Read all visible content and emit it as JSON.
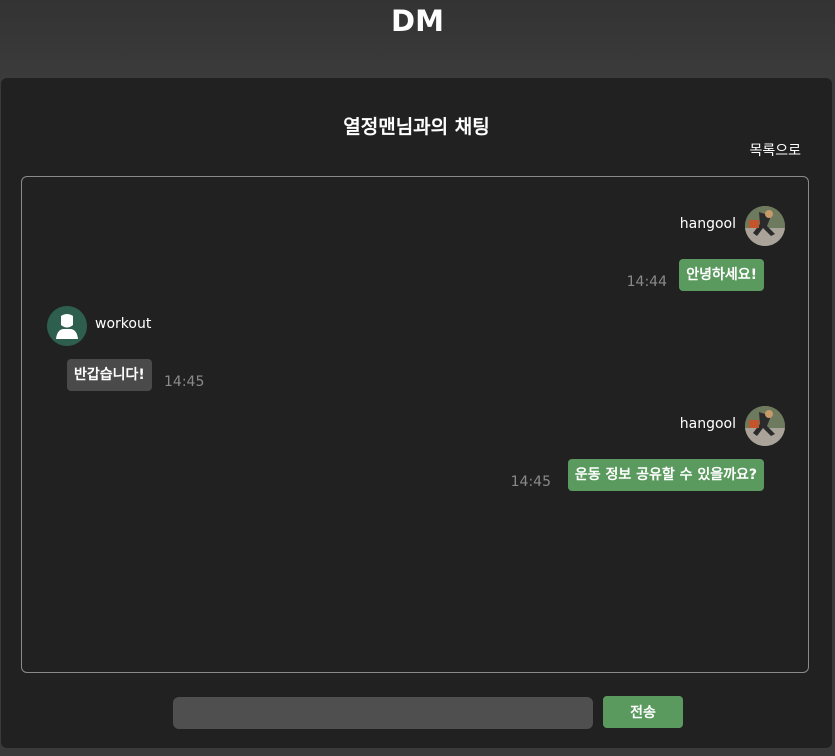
{
  "header": {
    "title": "DM"
  },
  "chat": {
    "title": "열정맨님과의 채팅",
    "back_link": "목록으로",
    "messages": [
      {
        "sender": "hangool",
        "text": "안녕하세요!",
        "time": "14:44",
        "mine": true,
        "avatar_icon": "profile-photo"
      },
      {
        "sender": "workout",
        "text": "반갑습니다!",
        "time": "14:45",
        "mine": false,
        "avatar_icon": "default-user-icon"
      },
      {
        "sender": "hangool",
        "text": "운동 정보 공유할 수 있을까요?",
        "time": "14:45",
        "mine": true,
        "avatar_icon": "profile-photo"
      }
    ]
  },
  "composer": {
    "input_value": "",
    "input_placeholder": "",
    "send_label": "전송"
  },
  "colors": {
    "background": "#3a3a3a",
    "panel": "#212121",
    "accent": "#5a9a5e",
    "other_bubble": "#4a4a4a",
    "time_text": "#8a8a8a"
  }
}
